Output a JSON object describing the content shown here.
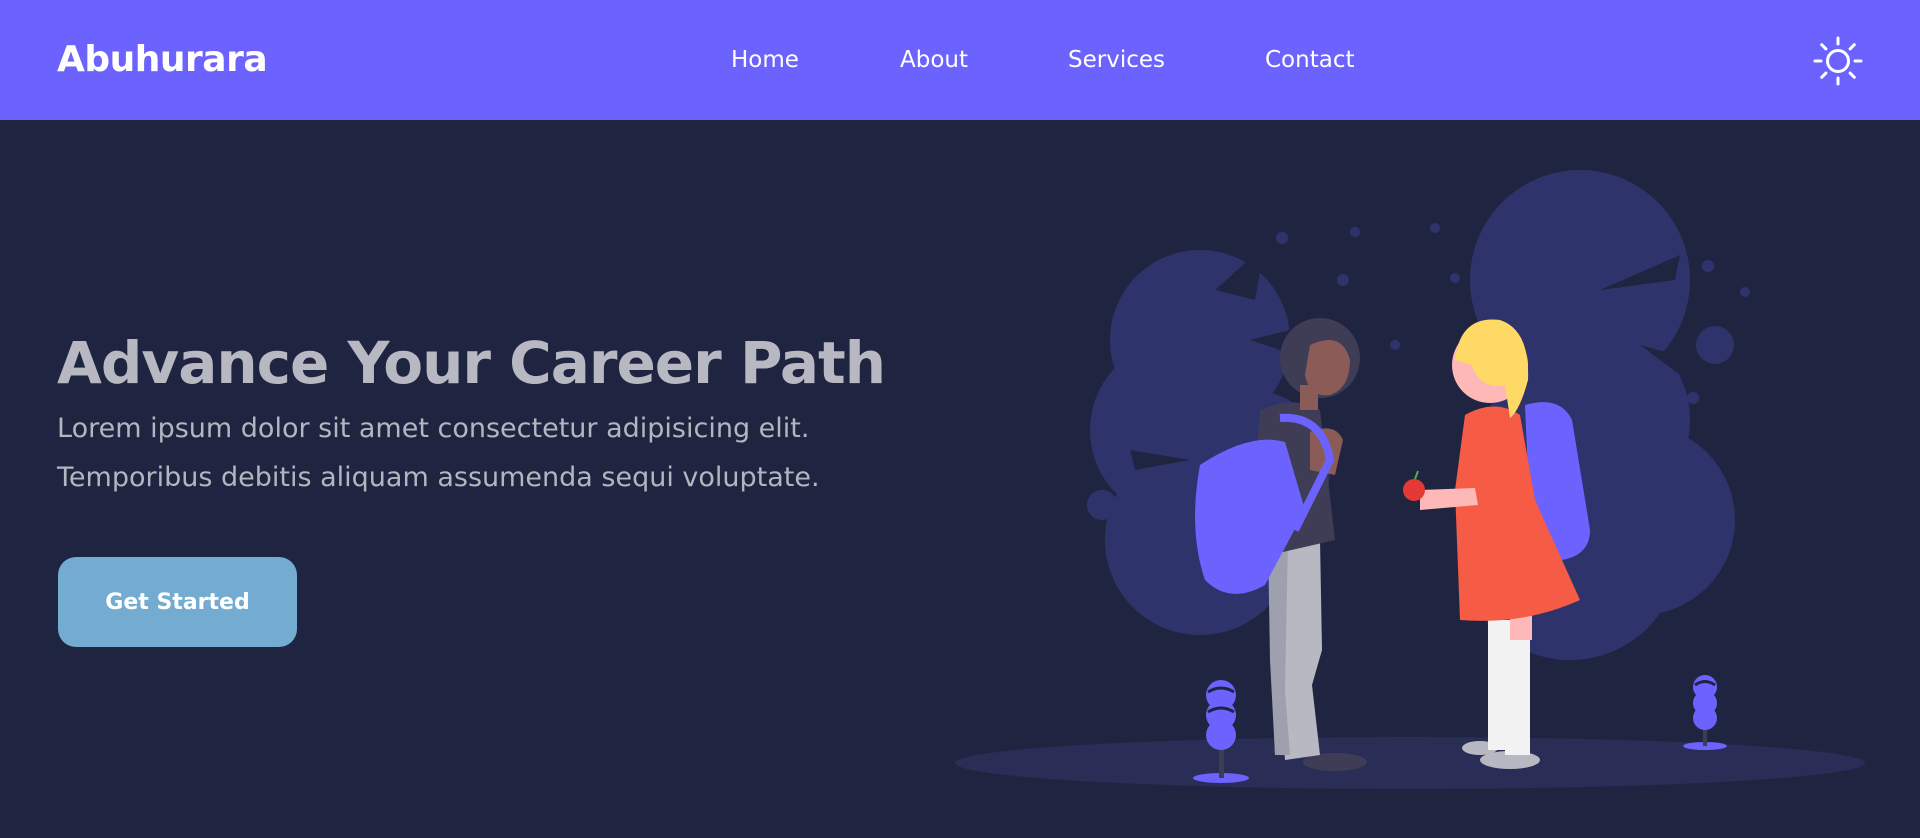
{
  "navbar": {
    "logo": "Abuhurara",
    "links": [
      {
        "label": "Home"
      },
      {
        "label": "About"
      },
      {
        "label": "Services"
      },
      {
        "label": "Contact"
      }
    ],
    "theme_toggle_icon": "sun-icon"
  },
  "hero": {
    "title": "Advance Your Career Path",
    "description_lines": [
      "Lorem ipsum dolor sit amet consectetur adipisicing elit.",
      "Temporibus debitis aliquam assumenda sequi voluptate."
    ],
    "cta_label": "Get Started"
  },
  "colors": {
    "navbar": "#6c63ff",
    "background": "#1f2541",
    "button": "#74abd1",
    "accent": "#6c63ff"
  }
}
